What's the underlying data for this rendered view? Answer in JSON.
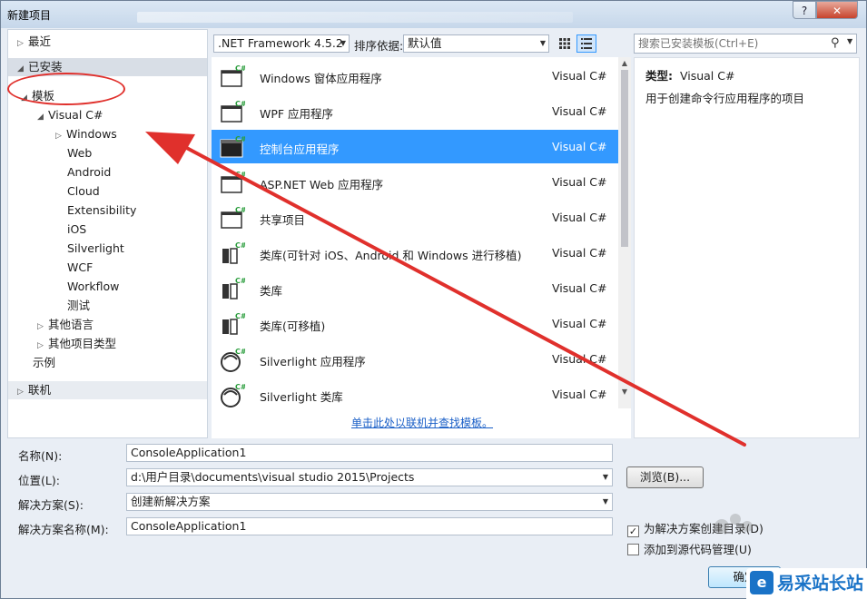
{
  "window": {
    "title": "新建项目",
    "help_label": "?",
    "close_label": "✕"
  },
  "nav": {
    "recent": "最近",
    "installed": "已安装",
    "templates": "模板",
    "visual_csharp": "Visual C#",
    "children": [
      "Windows",
      "Web",
      "Android",
      "Cloud",
      "Extensibility",
      "iOS",
      "Silverlight",
      "WCF",
      "Workflow",
      "测试"
    ],
    "other_languages": "其他语言",
    "other_project_types": "其他项目类型",
    "samples": "示例",
    "online": "联机"
  },
  "toolbar": {
    "framework": ".NET Framework 4.5.2",
    "sort_label": "排序依据:",
    "sort_value": "默认值"
  },
  "search": {
    "placeholder": "搜索已安装模板(Ctrl+E)"
  },
  "templates": [
    {
      "name": "Windows 窗体应用程序",
      "lang": "Visual C#",
      "icon": "windows-form-icon",
      "selected": false
    },
    {
      "name": "WPF 应用程序",
      "lang": "Visual C#",
      "icon": "wpf-app-icon",
      "selected": false
    },
    {
      "name": "控制台应用程序",
      "lang": "Visual C#",
      "icon": "console-app-icon",
      "selected": true
    },
    {
      "name": "ASP.NET Web 应用程序",
      "lang": "Visual C#",
      "icon": "web-app-icon",
      "selected": false
    },
    {
      "name": "共享项目",
      "lang": "Visual C#",
      "icon": "shared-project-icon",
      "selected": false
    },
    {
      "name": "类库(可针对 iOS、Android 和 Windows 进行移植)",
      "lang": "Visual C#",
      "icon": "portable-library-icon",
      "selected": false
    },
    {
      "name": "类库",
      "lang": "Visual C#",
      "icon": "class-library-icon",
      "selected": false
    },
    {
      "name": "类库(可移植)",
      "lang": "Visual C#",
      "icon": "portable-class-library-icon",
      "selected": false
    },
    {
      "name": "Silverlight 应用程序",
      "lang": "Visual C#",
      "icon": "silverlight-app-icon",
      "selected": false
    },
    {
      "name": "Silverlight 类库",
      "lang": "Visual C#",
      "icon": "silverlight-library-icon",
      "selected": false
    }
  ],
  "online_link": "单击此处以联机并查找模板。",
  "info": {
    "type_label": "类型:",
    "type_value": "Visual C#",
    "description": "用于创建命令行应用程序的项目"
  },
  "form": {
    "name_label": "名称(N):",
    "name_value": "ConsoleApplication1",
    "location_label": "位置(L):",
    "location_value": "d:\\用户目录\\documents\\visual studio 2015\\Projects",
    "solution_label": "解决方案(S):",
    "solution_value": "创建新解决方案",
    "solution_name_label": "解决方案名称(M):",
    "solution_name_value": "ConsoleApplication1",
    "browse_label": "浏览(B)...",
    "create_dir_label": "为解决方案创建目录(D)",
    "create_dir_checked": true,
    "source_control_label": "添加到源代码管理(U)",
    "source_control_checked": false,
    "ok_label": "确定"
  },
  "watermark": {
    "text": "易采站长站",
    "logo": "e"
  },
  "colors": {
    "selection": "#3399ff",
    "annotation": "#e0302c",
    "link": "#1a5fc7"
  }
}
